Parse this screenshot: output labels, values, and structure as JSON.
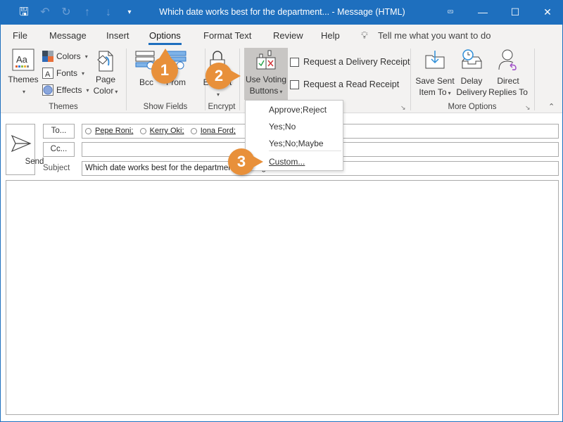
{
  "window": {
    "title": "Which date works best for the department... - Message (HTML)",
    "qat_icons": [
      "save-icon",
      "undo-icon",
      "redo-icon",
      "up-arrow-icon",
      "down-arrow-icon",
      "customize-qat-icon"
    ],
    "controls": [
      "ribbon-display-icon",
      "minimize-icon",
      "maximize-icon",
      "close-icon"
    ],
    "accent_color": "#1e6fbe"
  },
  "tabs": {
    "items": [
      "File",
      "Message",
      "Insert",
      "Options",
      "Format Text",
      "Review",
      "Help"
    ],
    "active": "Options",
    "tell_me": "Tell me what you want to do"
  },
  "ribbon": {
    "themes_group": {
      "label": "Themes",
      "themes_button": "Themes",
      "colors": "Colors",
      "fonts": "Fonts",
      "effects": "Effects",
      "page_color_line1": "Page",
      "page_color_line2": "Color"
    },
    "show_fields_group": {
      "label": "Show Fields",
      "bcc": "Bcc",
      "from": "From"
    },
    "encrypt_group": {
      "label": "Encrypt",
      "encrypt": "Encrypt"
    },
    "tracking_group": {
      "voting_line1": "Use Voting",
      "voting_line2": "Buttons",
      "delivery_receipt": "Request a Delivery Receipt",
      "read_receipt": "Request a Read Receipt",
      "delivery_receipt_checked": false,
      "read_receipt_checked": false
    },
    "more_options_group": {
      "label": "More Options",
      "save_sent_line1": "Save Sent",
      "save_sent_line2": "Item To",
      "delay_line1": "Delay",
      "delay_line2": "Delivery",
      "direct_line1": "Direct",
      "direct_line2": "Replies To"
    }
  },
  "voting_menu": {
    "items": [
      "Approve;Reject",
      "Yes;No",
      "Yes;No;Maybe",
      "Custom..."
    ]
  },
  "message": {
    "send": "Send",
    "to_button": "To...",
    "cc_button": "Cc...",
    "subject_label": "Subject",
    "recipients": [
      "Pepe Roni;",
      "Kerry Oki;",
      "Iona Ford;"
    ],
    "cc_value": "",
    "subject_value": "Which date works best for the department meeting?"
  },
  "callouts": [
    "1",
    "2",
    "3"
  ],
  "callout_color": "#e8903a"
}
